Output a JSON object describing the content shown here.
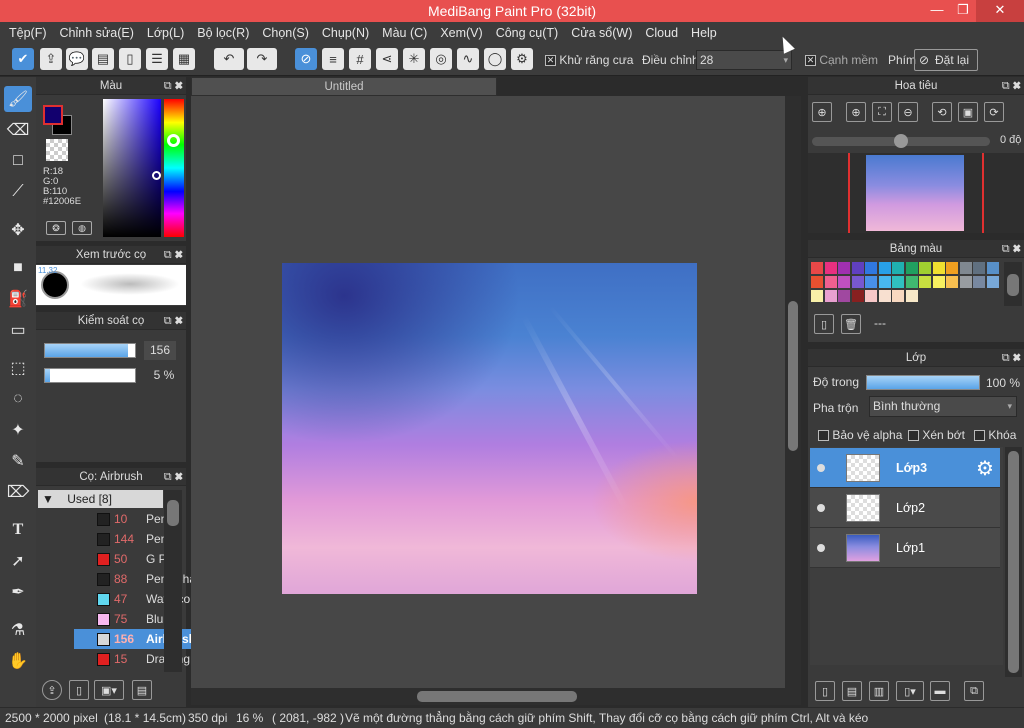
{
  "window": {
    "title": "MediBang Paint Pro (32bit)",
    "minimize": "—",
    "restore": "❐",
    "close": "✕"
  },
  "menu": [
    "Tệp(F)",
    "Chỉnh sửa(E)",
    "Lớp(L)",
    "Bộ lọc(R)",
    "Chọn(S)",
    "Chụp(N)",
    "Màu (C)",
    "Xem(V)",
    "Công cụ(T)",
    "Cửa sổ(W)",
    "Cloud",
    "Help"
  ],
  "toolbar": {
    "antialias_label": "Khử răng cưa",
    "antialias_checked": true,
    "adjust_label": "Điều chỉnh",
    "adjust_value": "28",
    "smooth_label": "Cạnh mềm",
    "smooth_checked": false,
    "shortcut_label": "Phím",
    "reset_label": "Đặt lại"
  },
  "color_panel": {
    "title": "Màu",
    "r": "R:18",
    "g": "G:0",
    "b": "B:110",
    "hex": "#12006E",
    "foreground": "#12006E",
    "background": "#000000"
  },
  "brush_preview": {
    "title": "Xem trước cọ",
    "size_label": "11.32"
  },
  "brush_control": {
    "title": "Kiểm soát cọ",
    "size_value": "156",
    "size_fraction": 0.92,
    "opacity_value": "5 %",
    "opacity_fraction": 0.05
  },
  "brush_list": {
    "title": "Cọ: Airbrush",
    "group": "Used [8]",
    "items": [
      {
        "num": "10",
        "name": "Pencil",
        "color": "#222222"
      },
      {
        "num": "144",
        "name": "Pen",
        "color": "#222222"
      },
      {
        "num": "50",
        "name": "G Pen",
        "color": "#e02020"
      },
      {
        "num": "88",
        "name": "Pen (Shar",
        "color": "#222222"
      },
      {
        "num": "47",
        "name": "Watercolo",
        "color": "#60d8f0"
      },
      {
        "num": "75",
        "name": "Blur",
        "color": "#f8b8f0"
      },
      {
        "num": "156",
        "name": "Airbrush",
        "color": "#d8d8d8",
        "selected": true
      },
      {
        "num": "15",
        "name": "Drawing P",
        "color": "#e02020"
      }
    ]
  },
  "document": {
    "tab": "Untitled"
  },
  "navigator": {
    "title": "Hoa tiêu",
    "angle": "0 độ"
  },
  "palette": {
    "title": "Bảng màu",
    "name": "---",
    "rows": [
      [
        "#e84848",
        "#e83080",
        "#a030b0",
        "#6040c0",
        "#3078e0",
        "#28a0e8",
        "#20b0b0",
        "#20a060",
        "#a0d030",
        "#f0e030",
        "#f0a020",
        "#808890",
        "#607080",
        "#5890c8"
      ],
      [
        "#e85030",
        "#f06090",
        "#c050c0",
        "#7858d0",
        "#4890e8",
        "#48b8f0",
        "#30c0c0",
        "#40b870",
        "#c8e040",
        "#f8f060",
        "#f8c050",
        "#989ca0",
        "#7888a0",
        "#78a8d8"
      ],
      [
        "#f8f0a8",
        "#e8a0d0",
        "#a048a0",
        "#882020",
        "#f8c8c8",
        "#f8e0d0",
        "#f8d8c0",
        "#f8e8c8"
      ]
    ]
  },
  "layers": {
    "title": "Lớp",
    "opacity_label": "Độ trong",
    "opacity_value": "100 %",
    "opacity_fraction": 1.0,
    "blend_label": "Pha trộn",
    "blend_value": "Bình thường",
    "protect_alpha": "Bảo vệ alpha",
    "clipping": "Xén bớt",
    "lock": "Khóa",
    "items": [
      {
        "name": "Lớp3",
        "selected": true
      },
      {
        "name": "Lớp2",
        "selected": false
      },
      {
        "name": "Lớp1",
        "selected": false
      }
    ]
  },
  "status": {
    "size": "2500 * 2000 pixel",
    "physical": "(18.1 * 14.5cm)",
    "dpi": "350 dpi",
    "zoom": "16 %",
    "coords": "( 2081, -982 )",
    "hint": "Vẽ một đường thẳng bằng cách giữ phím Shift, Thay đổi cỡ cọ bằng cách giữ phím Ctrl, Alt và kéo"
  },
  "icons": [
    "brush-icon",
    "eraser-icon",
    "rect-icon",
    "line-icon",
    "move-icon",
    "fill-rect-icon",
    "bucket-icon",
    "gradient-icon",
    "select-rect-icon",
    "lasso-icon",
    "magic-wand-icon",
    "select-pen-icon",
    "select-eraser-icon",
    "text-icon",
    "operation-icon",
    "dropper-icon",
    "hand-icon"
  ]
}
